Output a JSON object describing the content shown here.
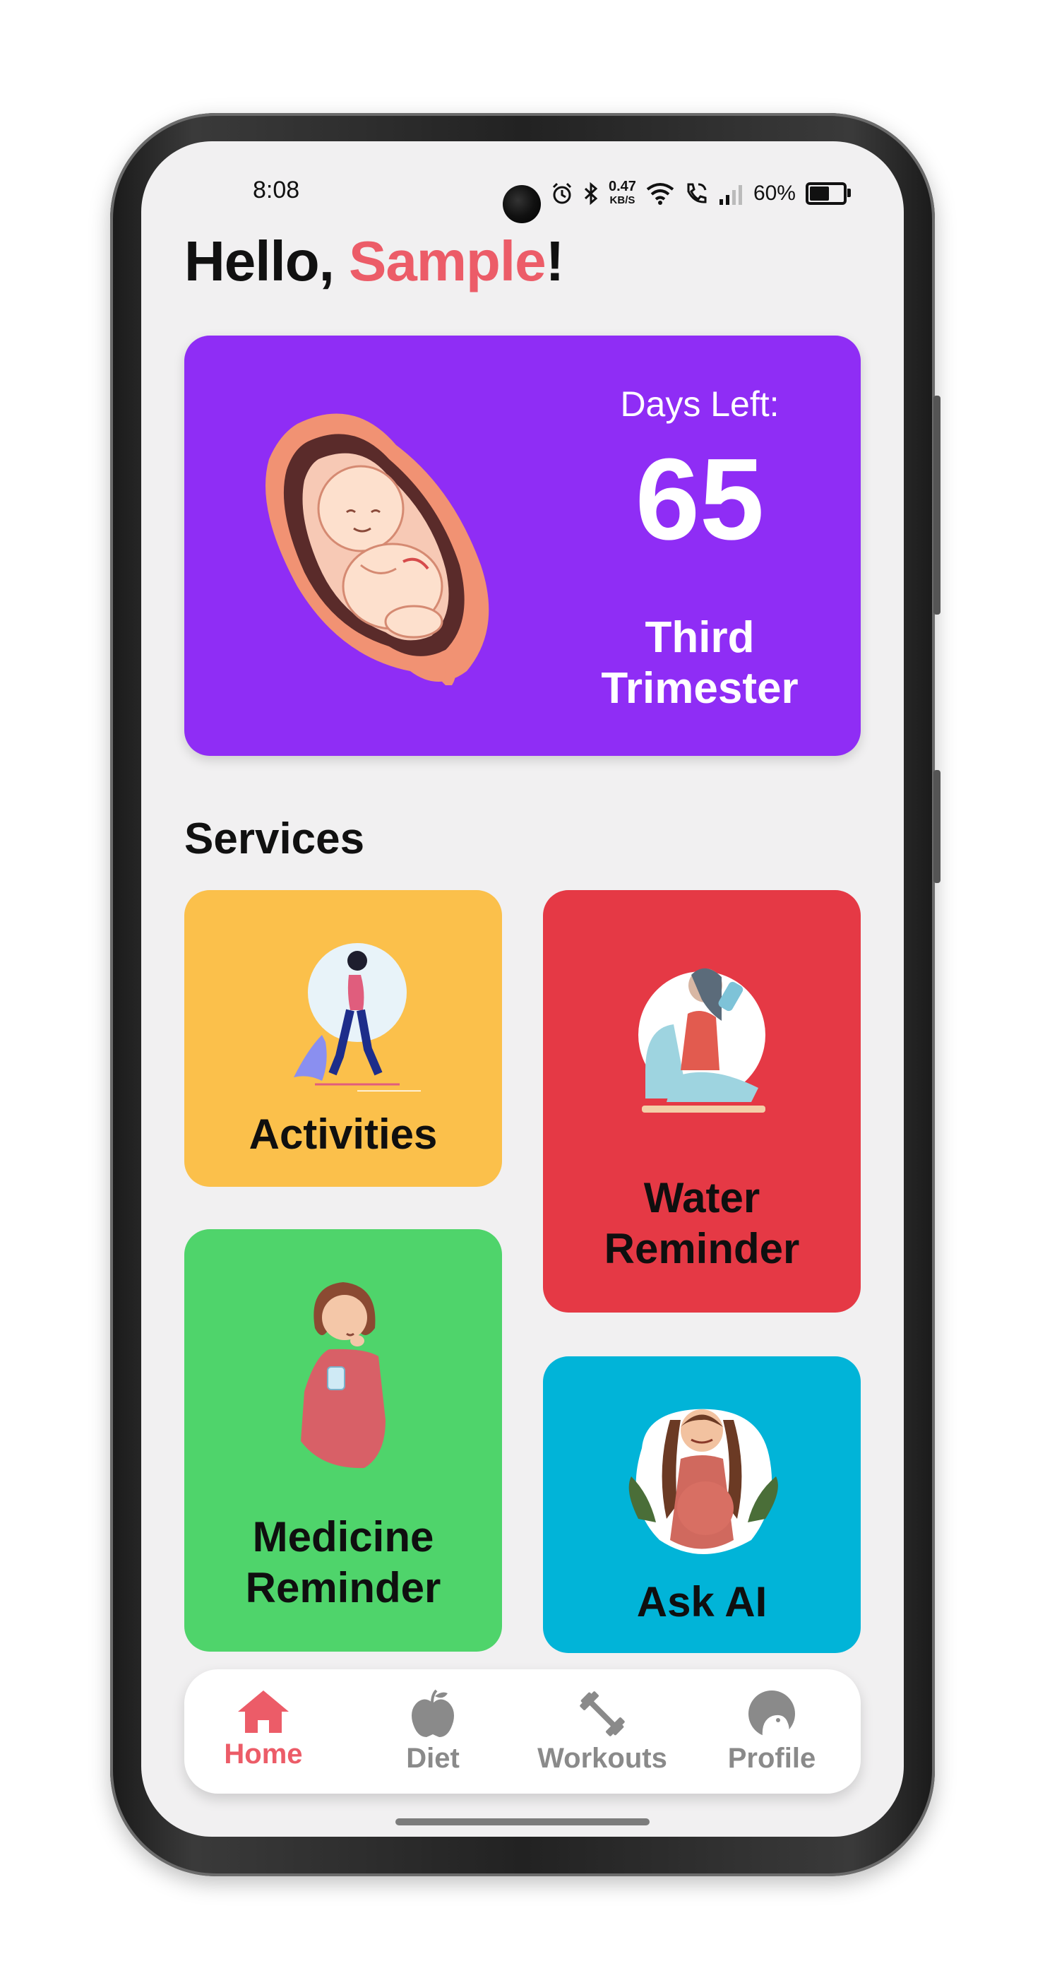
{
  "status_bar": {
    "time": "8:08",
    "net_speed_value": "0.47",
    "net_speed_unit": "KB/S",
    "battery": "60%",
    "icons": [
      "alarm-icon",
      "bluetooth-icon",
      "wifi-icon",
      "wifi-call-icon",
      "signal-icon",
      "battery-icon"
    ]
  },
  "greeting": {
    "prefix": "Hello, ",
    "name": "Sample",
    "suffix": "!"
  },
  "pregnancy_card": {
    "days_label": "Days Left:",
    "days_left": "65",
    "trimester_line1": "Third",
    "trimester_line2": "Trimester",
    "color": "#8f2df5"
  },
  "services": {
    "title": "Services",
    "items": [
      {
        "label": "Activities",
        "color": "#fbc04b"
      },
      {
        "label_line1": "Water",
        "label_line2": "Reminder",
        "color": "#e53945"
      },
      {
        "label_line1": "Medicine",
        "label_line2": "Reminder",
        "color": "#4fd46b"
      },
      {
        "label": "Ask AI",
        "color": "#01b4d8"
      }
    ]
  },
  "bottom_nav": {
    "items": [
      {
        "label": "Home",
        "icon": "home-icon",
        "active": true
      },
      {
        "label": "Diet",
        "icon": "apple-icon",
        "active": false
      },
      {
        "label": "Workouts",
        "icon": "dumbbell-icon",
        "active": false
      },
      {
        "label": "Profile",
        "icon": "profile-icon",
        "active": false
      }
    ],
    "active_color": "#ec5c68",
    "inactive_color": "#8a8a8a"
  }
}
